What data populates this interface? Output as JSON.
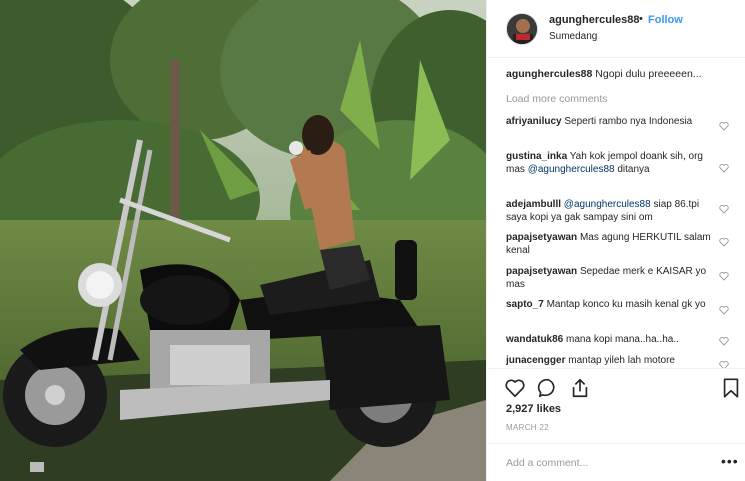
{
  "header": {
    "username": "agunghercules88",
    "dot": "•",
    "follow_label": "Follow",
    "location": "Sumedang"
  },
  "caption": {
    "username": "agunghercules88",
    "text": "Ngopi dulu preeeeen..."
  },
  "load_more": "Load more comments",
  "comments": [
    {
      "user": "afriyanilucy",
      "text": "Seperti rambo nya Indonesia"
    },
    {
      "user": "gustina_inka",
      "text": "Yah kok jempol doank sih, org mas",
      "mention": "@agunghercules88",
      "text_after": "ditanya"
    },
    {
      "user": "adejambulll",
      "mention": "@agunghercules88",
      "text": "siap 86.tpi saya kopi ya gak sampay sini om"
    },
    {
      "user": "papajsetyawan",
      "text": "Mas agung HERKUTIL salam kenal"
    },
    {
      "user": "papajsetyawan",
      "text": "Sepedae merk e KAISAR yo mas"
    },
    {
      "user": "sapto_7",
      "text": "Mantap konco ku masih kenal gk yo"
    },
    {
      "user": "wandatuk86",
      "text": "mana kopi mana..ha..ha.."
    },
    {
      "user": "junacengger",
      "text": "mantap yileh lah motore"
    }
  ],
  "likes": "2,927 likes",
  "date": "MARCH 22",
  "add_comment": {
    "placeholder": "Add a comment..."
  },
  "more_label": "•••",
  "icons": {
    "like": "heart-icon",
    "comment": "speech-bubble-icon",
    "share": "share-icon",
    "save": "bookmark-icon",
    "comment_like": "small-heart-icon"
  },
  "colors": {
    "follow": "#3897f0",
    "mention": "#003569",
    "muted": "#999999",
    "text": "#262626"
  }
}
